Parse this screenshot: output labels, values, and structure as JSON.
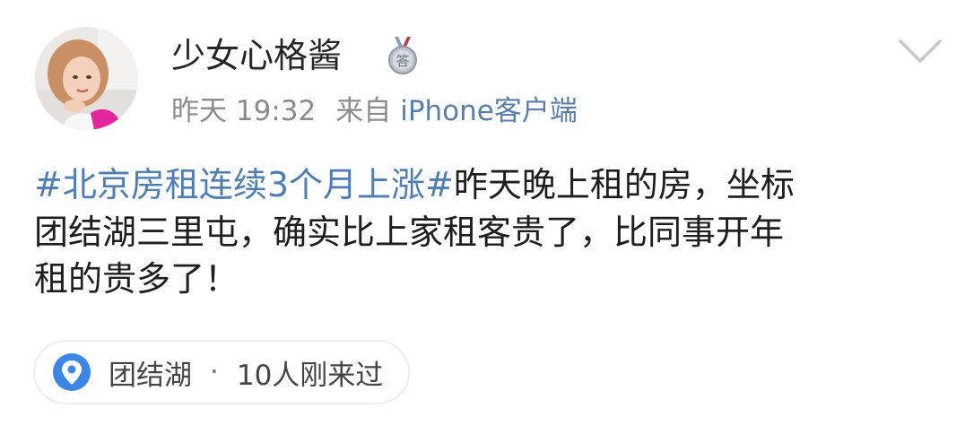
{
  "post": {
    "username": "少女心格酱",
    "medal_icon": "answer-medal-icon",
    "medal_text": "答",
    "time": "昨天 19:32",
    "source_prefix": "来自",
    "source_client": "iPhone客户端",
    "content": {
      "topic": "#北京房租连续3个月上涨#",
      "line1_rest": "昨天晚上租的房，坐标",
      "line2": "团结湖三里屯，确实比上家租客贵了，比同事开年",
      "line3": "租的贵多了！"
    },
    "location": {
      "icon": "location-pin-icon",
      "name": "团结湖",
      "separator": "·",
      "visitors": "10人刚来过"
    }
  },
  "colors": {
    "link_blue": "#4e7eb2",
    "meta_grey": "#8c8c8c",
    "pin_blue": "#3b86e6"
  }
}
